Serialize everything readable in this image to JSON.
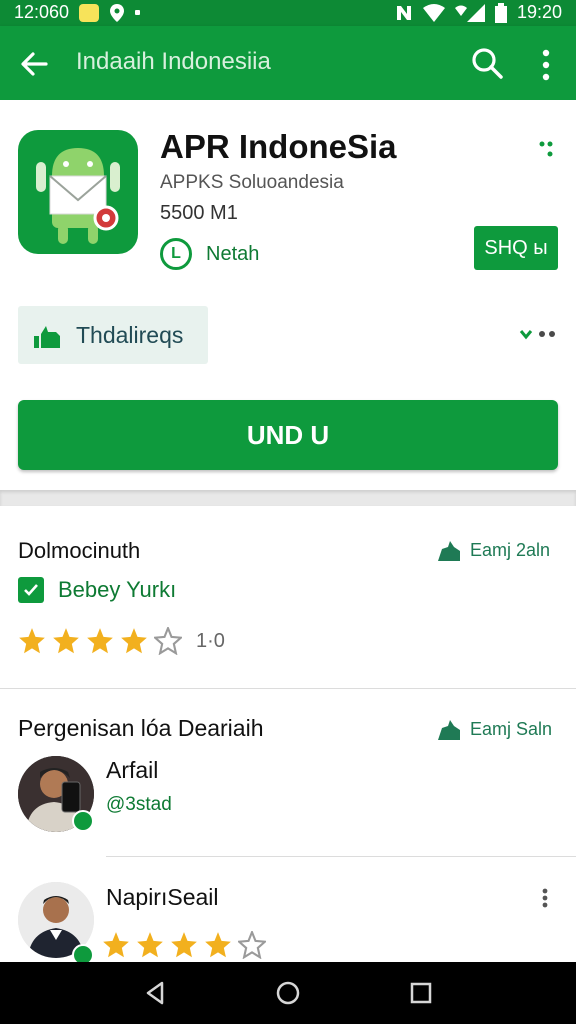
{
  "status_bar": {
    "left_text": "12:060",
    "time": "19:20"
  },
  "app_bar": {
    "title": "Indaaih Indonesiia"
  },
  "app": {
    "name": "APR IndoneSia",
    "publisher": "APPKS Soluoandesia",
    "size": "5500 M1",
    "badge_label": "Netah",
    "badge_symbol": "L",
    "small_button": "SHQ ы",
    "chip_label": "Thdalireqs",
    "install_label": "UND U"
  },
  "section1": {
    "title": "Dolmocinuth",
    "link": "Eamj 2aln",
    "check_label": "Bebey Yurkı",
    "rating": 4,
    "rating_text": "1·0"
  },
  "section2": {
    "title": "Pergenisan lóa Deariaih",
    "link": "Eamj Saln",
    "reviews": [
      {
        "name": "Arfail",
        "handle": "@3stad"
      },
      {
        "name": "NapirıSeail",
        "rating": 4
      }
    ]
  },
  "colors": {
    "primary": "#0e9a3d",
    "status_bar": "#0d8a35",
    "star": "#f2b01e",
    "nav_bar": "#000000"
  }
}
